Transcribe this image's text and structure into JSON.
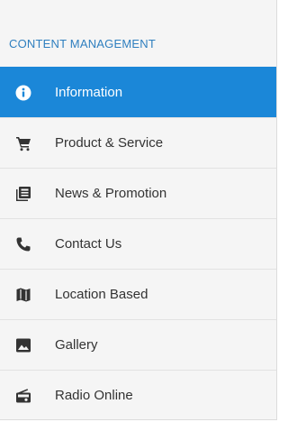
{
  "sidebar": {
    "section_title": "CONTENT MANAGEMENT",
    "items": [
      {
        "label": "Information",
        "icon": "info-icon",
        "active": true
      },
      {
        "label": "Product & Service",
        "icon": "cart-icon",
        "active": false
      },
      {
        "label": "News & Promotion",
        "icon": "newspaper-icon",
        "active": false
      },
      {
        "label": "Contact Us",
        "icon": "phone-icon",
        "active": false
      },
      {
        "label": "Location Based",
        "icon": "map-icon",
        "active": false
      },
      {
        "label": "Gallery",
        "icon": "image-icon",
        "active": false
      },
      {
        "label": "Radio Online",
        "icon": "radio-icon",
        "active": false
      }
    ]
  },
  "colors": {
    "accent": "#1b87d8",
    "section_title": "#2f7fbf",
    "background": "#f5f5f5",
    "text": "#333333"
  }
}
